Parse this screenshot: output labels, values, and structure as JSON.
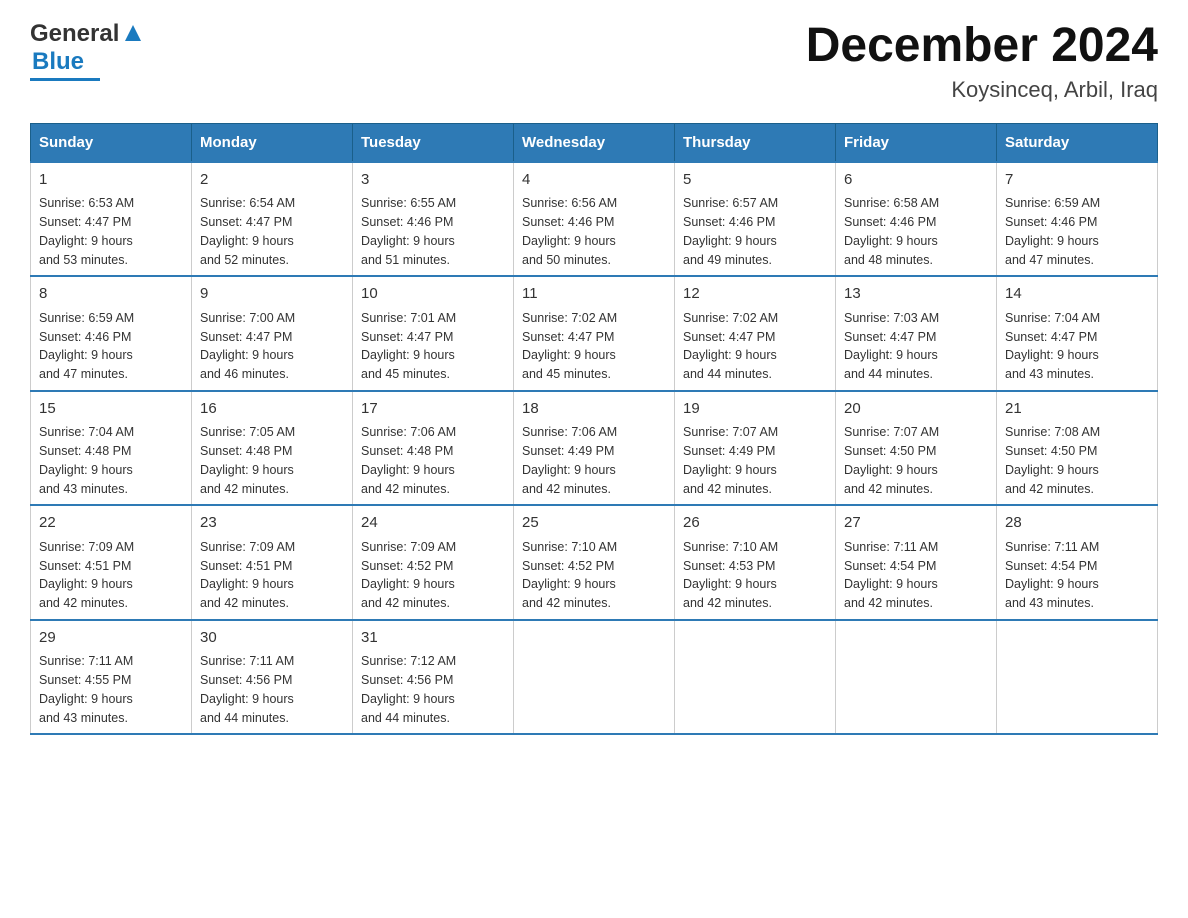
{
  "header": {
    "logo_general": "General",
    "logo_blue": "Blue",
    "month_year": "December 2024",
    "location": "Koysinceq, Arbil, Iraq"
  },
  "days_of_week": [
    "Sunday",
    "Monday",
    "Tuesday",
    "Wednesday",
    "Thursday",
    "Friday",
    "Saturday"
  ],
  "weeks": [
    [
      {
        "day": "1",
        "sunrise": "6:53 AM",
        "sunset": "4:47 PM",
        "daylight": "9 hours and 53 minutes."
      },
      {
        "day": "2",
        "sunrise": "6:54 AM",
        "sunset": "4:47 PM",
        "daylight": "9 hours and 52 minutes."
      },
      {
        "day": "3",
        "sunrise": "6:55 AM",
        "sunset": "4:46 PM",
        "daylight": "9 hours and 51 minutes."
      },
      {
        "day": "4",
        "sunrise": "6:56 AM",
        "sunset": "4:46 PM",
        "daylight": "9 hours and 50 minutes."
      },
      {
        "day": "5",
        "sunrise": "6:57 AM",
        "sunset": "4:46 PM",
        "daylight": "9 hours and 49 minutes."
      },
      {
        "day": "6",
        "sunrise": "6:58 AM",
        "sunset": "4:46 PM",
        "daylight": "9 hours and 48 minutes."
      },
      {
        "day": "7",
        "sunrise": "6:59 AM",
        "sunset": "4:46 PM",
        "daylight": "9 hours and 47 minutes."
      }
    ],
    [
      {
        "day": "8",
        "sunrise": "6:59 AM",
        "sunset": "4:46 PM",
        "daylight": "9 hours and 47 minutes."
      },
      {
        "day": "9",
        "sunrise": "7:00 AM",
        "sunset": "4:47 PM",
        "daylight": "9 hours and 46 minutes."
      },
      {
        "day": "10",
        "sunrise": "7:01 AM",
        "sunset": "4:47 PM",
        "daylight": "9 hours and 45 minutes."
      },
      {
        "day": "11",
        "sunrise": "7:02 AM",
        "sunset": "4:47 PM",
        "daylight": "9 hours and 45 minutes."
      },
      {
        "day": "12",
        "sunrise": "7:02 AM",
        "sunset": "4:47 PM",
        "daylight": "9 hours and 44 minutes."
      },
      {
        "day": "13",
        "sunrise": "7:03 AM",
        "sunset": "4:47 PM",
        "daylight": "9 hours and 44 minutes."
      },
      {
        "day": "14",
        "sunrise": "7:04 AM",
        "sunset": "4:47 PM",
        "daylight": "9 hours and 43 minutes."
      }
    ],
    [
      {
        "day": "15",
        "sunrise": "7:04 AM",
        "sunset": "4:48 PM",
        "daylight": "9 hours and 43 minutes."
      },
      {
        "day": "16",
        "sunrise": "7:05 AM",
        "sunset": "4:48 PM",
        "daylight": "9 hours and 42 minutes."
      },
      {
        "day": "17",
        "sunrise": "7:06 AM",
        "sunset": "4:48 PM",
        "daylight": "9 hours and 42 minutes."
      },
      {
        "day": "18",
        "sunrise": "7:06 AM",
        "sunset": "4:49 PM",
        "daylight": "9 hours and 42 minutes."
      },
      {
        "day": "19",
        "sunrise": "7:07 AM",
        "sunset": "4:49 PM",
        "daylight": "9 hours and 42 minutes."
      },
      {
        "day": "20",
        "sunrise": "7:07 AM",
        "sunset": "4:50 PM",
        "daylight": "9 hours and 42 minutes."
      },
      {
        "day": "21",
        "sunrise": "7:08 AM",
        "sunset": "4:50 PM",
        "daylight": "9 hours and 42 minutes."
      }
    ],
    [
      {
        "day": "22",
        "sunrise": "7:09 AM",
        "sunset": "4:51 PM",
        "daylight": "9 hours and 42 minutes."
      },
      {
        "day": "23",
        "sunrise": "7:09 AM",
        "sunset": "4:51 PM",
        "daylight": "9 hours and 42 minutes."
      },
      {
        "day": "24",
        "sunrise": "7:09 AM",
        "sunset": "4:52 PM",
        "daylight": "9 hours and 42 minutes."
      },
      {
        "day": "25",
        "sunrise": "7:10 AM",
        "sunset": "4:52 PM",
        "daylight": "9 hours and 42 minutes."
      },
      {
        "day": "26",
        "sunrise": "7:10 AM",
        "sunset": "4:53 PM",
        "daylight": "9 hours and 42 minutes."
      },
      {
        "day": "27",
        "sunrise": "7:11 AM",
        "sunset": "4:54 PM",
        "daylight": "9 hours and 42 minutes."
      },
      {
        "day": "28",
        "sunrise": "7:11 AM",
        "sunset": "4:54 PM",
        "daylight": "9 hours and 43 minutes."
      }
    ],
    [
      {
        "day": "29",
        "sunrise": "7:11 AM",
        "sunset": "4:55 PM",
        "daylight": "9 hours and 43 minutes."
      },
      {
        "day": "30",
        "sunrise": "7:11 AM",
        "sunset": "4:56 PM",
        "daylight": "9 hours and 44 minutes."
      },
      {
        "day": "31",
        "sunrise": "7:12 AM",
        "sunset": "4:56 PM",
        "daylight": "9 hours and 44 minutes."
      },
      null,
      null,
      null,
      null
    ]
  ],
  "labels": {
    "sunrise": "Sunrise:",
    "sunset": "Sunset:",
    "daylight": "Daylight:"
  }
}
